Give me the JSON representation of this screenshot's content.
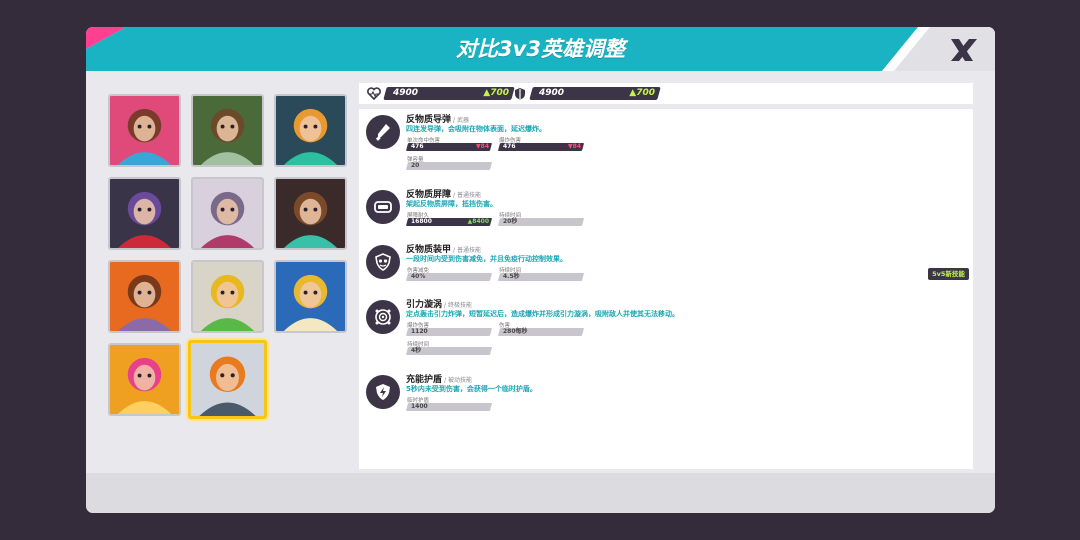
{
  "dialog": {
    "title": "对比3v3英雄调整",
    "colors": {
      "accent": "#1ab3c3",
      "pink": "#ff3f8f",
      "dark": "#3c3548",
      "highlight": "#f5c518",
      "up": "#c6f24e"
    }
  },
  "roster": {
    "portraits": [
      {
        "name": "hero-portrait-1",
        "colors": [
          "#e04a7a",
          "#7a3b2a",
          "#3aa6d8"
        ]
      },
      {
        "name": "hero-portrait-2",
        "colors": [
          "#4a6a3a",
          "#6a4a2a",
          "#a0c0a0"
        ]
      },
      {
        "name": "hero-portrait-3",
        "colors": [
          "#2a4a5a",
          "#e89a30",
          "#2ac0a0"
        ]
      },
      {
        "name": "hero-portrait-4",
        "colors": [
          "#3a3448",
          "#6a4a9a",
          "#cc2a3a"
        ]
      },
      {
        "name": "hero-portrait-5",
        "colors": [
          "#d8d0dc",
          "#7a6a8a",
          "#b03a6a"
        ]
      },
      {
        "name": "hero-portrait-6",
        "colors": [
          "#3a2a2a",
          "#7a4a2a",
          "#38c0a8"
        ]
      },
      {
        "name": "hero-portrait-7",
        "colors": [
          "#e86a20",
          "#7a3a1a",
          "#8a6aa8"
        ]
      },
      {
        "name": "hero-portrait-8",
        "colors": [
          "#d8d4c8",
          "#e8b820",
          "#5ab848"
        ]
      },
      {
        "name": "hero-portrait-9",
        "colors": [
          "#2a6ab8",
          "#e8b830",
          "#f4e8c0"
        ]
      },
      {
        "name": "hero-portrait-10",
        "colors": [
          "#f0a020",
          "#e8408a",
          "#ffd060"
        ]
      },
      {
        "name": "hero-portrait-11",
        "colors": [
          "#d0d4dc",
          "#e87a20",
          "#4a5a6a"
        ]
      }
    ],
    "selected_index": 10
  },
  "stats": {
    "health": {
      "icon": "heart-pulse-icon",
      "value": "4900",
      "delta": "700"
    },
    "shield": {
      "icon": "shield-icon",
      "value": "4900",
      "delta": "700"
    }
  },
  "skills": [
    {
      "icon": "missile-icon",
      "name": "反物质导弹",
      "tag": "/ 武器",
      "desc": "四连发导弹，会吸附在物体表面，延迟爆炸。",
      "fields": [
        {
          "label": "单次命中伤害",
          "value": "476",
          "delta": "84",
          "direction": "down",
          "dark": true
        },
        {
          "label": "爆炸伤害",
          "value": "476",
          "delta": "84",
          "direction": "down",
          "dark": true
        },
        {
          "label": "弹容量",
          "value": "20",
          "delta": "",
          "direction": "",
          "dark": false
        }
      ]
    },
    {
      "icon": "barrier-icon",
      "name": "反物质屏障",
      "tag": "/ 普通技能",
      "desc": "架起反物质屏障，抵挡伤害。",
      "fields": [
        {
          "label": "屏障耐久",
          "value": "16800",
          "delta": "8400",
          "direction": "up",
          "dark": true
        },
        {
          "label": "持续时间",
          "value": "20秒",
          "delta": "",
          "direction": "",
          "dark": false
        }
      ]
    },
    {
      "icon": "armor-icon",
      "name": "反物质装甲",
      "tag": "/ 普通技能",
      "desc": "一段时间内受到伤害减免，并且免疫行动控制效果。",
      "badge": "5v5新技能",
      "fields": [
        {
          "label": "伤害减免",
          "value": "40%",
          "delta": "",
          "direction": "",
          "dark": false
        },
        {
          "label": "持续时间",
          "value": "4.5秒",
          "delta": "",
          "direction": "",
          "dark": false
        }
      ]
    },
    {
      "icon": "vortex-icon",
      "name": "引力漩涡",
      "tag": "/ 终极技能",
      "desc": "定点轰击引力炸弹，短暂延迟后，造成爆炸并形成引力漩涡，吸附敌人并使其无法移动。",
      "fields": [
        {
          "label": "爆炸伤害",
          "value": "1120",
          "delta": "",
          "direction": "",
          "dark": false
        },
        {
          "label": "伤害",
          "value": "280每秒",
          "delta": "",
          "direction": "",
          "dark": false
        },
        {
          "label": "持续时间",
          "value": "4秒",
          "delta": "",
          "direction": "",
          "dark": false
        }
      ]
    },
    {
      "icon": "shield-charge-icon",
      "name": "充能护盾",
      "tag": "/ 被动技能",
      "desc": "5秒内未受到伤害，会获得一个临时护盾。",
      "fields": [
        {
          "label": "临时护盾",
          "value": "1400",
          "delta": "",
          "direction": "",
          "dark": false
        }
      ]
    }
  ]
}
